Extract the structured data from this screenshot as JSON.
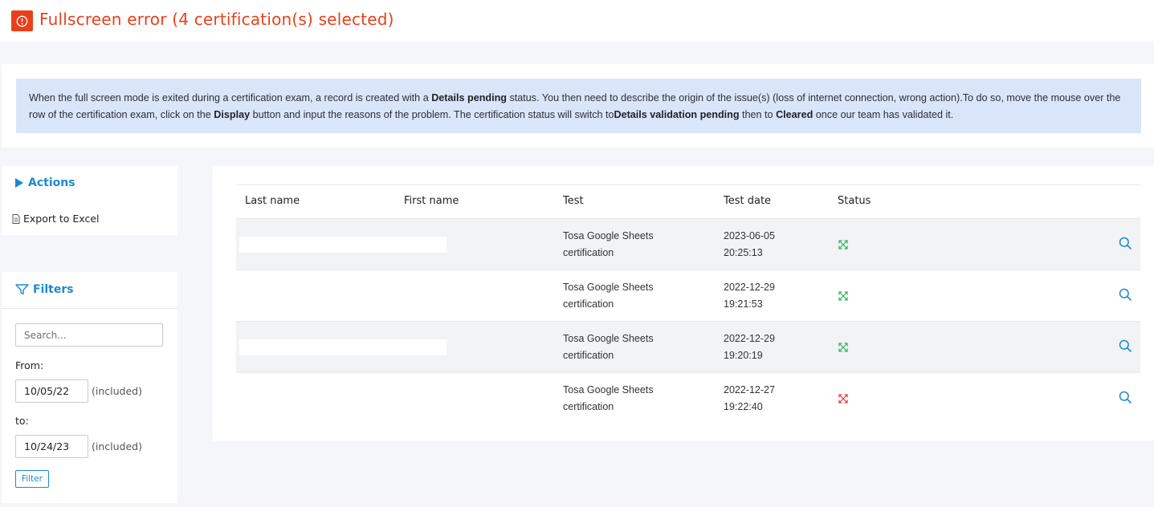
{
  "header": {
    "title": "Fullscreen error (4 certification(s) selected)",
    "icon": "alert-circle-icon",
    "accent_color": "#e8401d"
  },
  "info": {
    "p1": "When the full screen mode is exited during a certification exam, a record is created with a ",
    "b1": "Details pending",
    "p2": " status. You then need to describe the origin of the issue(s) (loss of internet connection, wrong action).To do so, move the mouse over the row of the certification exam, click on the ",
    "b2": "Display",
    "p3": " button and input the reasons of the problem. The certification status will switch to",
    "b3": "Details validation pending",
    "p4": " then to ",
    "b4": "Cleared",
    "p5": " once our team has validated it."
  },
  "actions": {
    "title": "Actions",
    "export_label": "Export to Excel"
  },
  "filters": {
    "title": "Filters",
    "search_placeholder": "Search...",
    "from_label": "From:",
    "from_value": "10/05/22",
    "to_label": "to:",
    "to_value": "10/24/23",
    "included_note": "(included)",
    "filter_button": "Filter"
  },
  "table": {
    "columns": [
      "Last name",
      "First name",
      "Test",
      "Test date",
      "Status"
    ],
    "rows": [
      {
        "test_line1": "Tosa Google Sheets",
        "test_line2": "certification",
        "date": "2023-06-05",
        "time": "20:25:13",
        "status": "ok"
      },
      {
        "test_line1": "Tosa Google Sheets",
        "test_line2": "certification",
        "date": "2022-12-29",
        "time": "19:21:53",
        "status": "ok"
      },
      {
        "test_line1": "Tosa Google Sheets",
        "test_line2": "certification",
        "date": "2022-12-29",
        "time": "19:20:19",
        "status": "ok"
      },
      {
        "test_line1": "Tosa Google Sheets",
        "test_line2": "certification",
        "date": "2022-12-27",
        "time": "19:22:40",
        "status": "error"
      }
    ],
    "status_colors": {
      "ok": "#2fb35a",
      "error": "#e03a3a"
    }
  }
}
